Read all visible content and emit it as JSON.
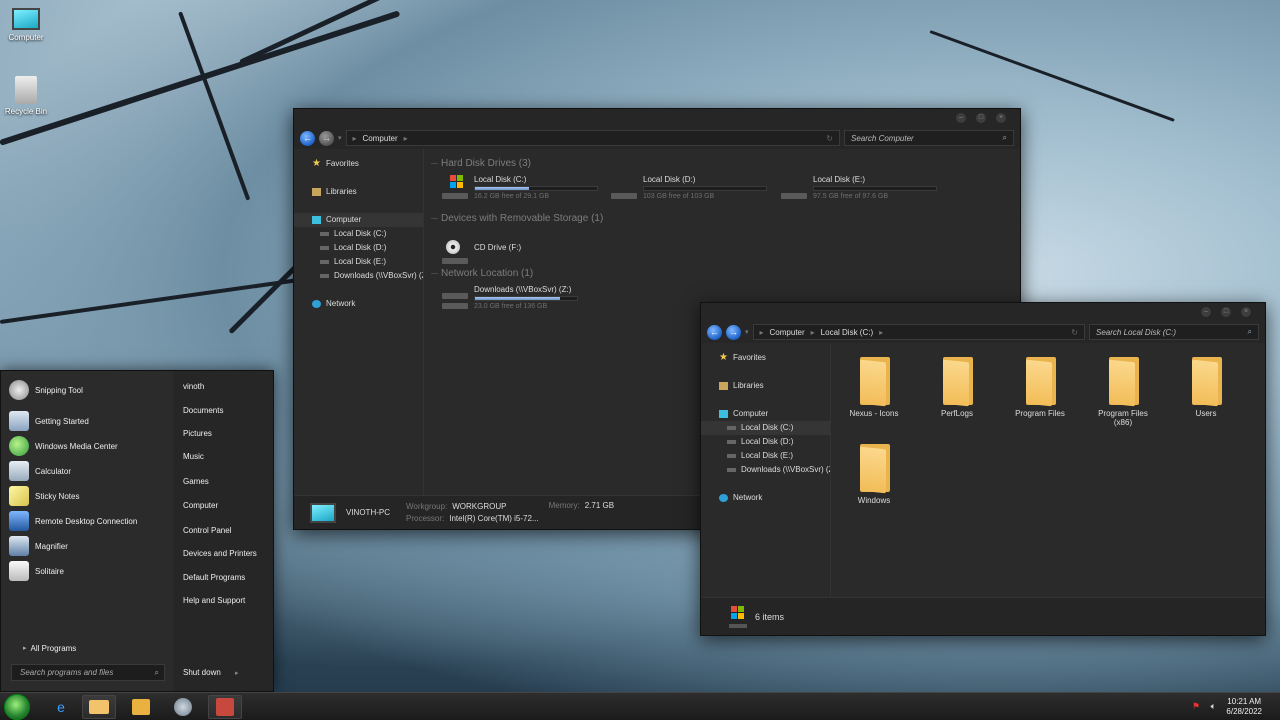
{
  "desktop": {
    "icons": [
      {
        "label": "Computer"
      },
      {
        "label": "Recycle Bin"
      }
    ]
  },
  "explorer_main": {
    "address": [
      "Computer"
    ],
    "search_placeholder": "Search Computer",
    "nav": {
      "favorites": "Favorites",
      "libraries": "Libraries",
      "computer": "Computer",
      "drives": [
        "Local Disk (C:)",
        "Local Disk (D:)",
        "Local Disk (E:)",
        "Downloads (\\\\VBoxSvr) (Z:)"
      ],
      "network": "Network"
    },
    "groups": {
      "hdd": "Hard Disk Drives (3)",
      "removable": "Devices with Removable Storage (1)",
      "network": "Network Location (1)"
    },
    "drives": [
      {
        "name": "Local Disk (C:)",
        "free": "16.2 GB free of 29.1 GB",
        "used_fraction": 0.44
      },
      {
        "name": "Local Disk (D:)",
        "free": "103 GB free of 103 GB",
        "used_fraction": 0.0
      },
      {
        "name": "Local Disk (E:)",
        "free": "97.5 GB free of 97.6 GB",
        "used_fraction": 0.0
      },
      {
        "name": "CD Drive (F:)"
      },
      {
        "name": "Downloads (\\\\VBoxSvr) (Z:)",
        "free": "23.0 GB free of 136 GB",
        "used_fraction": 0.83
      }
    ],
    "details": {
      "pc_name": "VINOTH-PC",
      "workgroup_label": "Workgroup:",
      "workgroup": "WORKGROUP",
      "memory_label": "Memory:",
      "memory": "2.71 GB",
      "processor_label": "Processor:",
      "processor": "Intel(R) Core(TM) i5-72..."
    }
  },
  "explorer_c": {
    "address": [
      "Computer",
      "Local Disk (C:)"
    ],
    "search_placeholder": "Search Local Disk (C:)",
    "nav": {
      "favorites": "Favorites",
      "libraries": "Libraries",
      "computer": "Computer",
      "drives": [
        "Local Disk (C:)",
        "Local Disk (D:)",
        "Local Disk (E:)",
        "Downloads (\\\\VBoxSvr) (Z:)"
      ],
      "network": "Network"
    },
    "folders": [
      "Nexus - Icons",
      "PerfLogs",
      "Program Files",
      "Program Files (x86)",
      "Users",
      "Windows"
    ],
    "status": "6 items"
  },
  "start_menu": {
    "programs": [
      "Snipping Tool",
      "Getting Started",
      "Windows Media Center",
      "Calculator",
      "Sticky Notes",
      "Remote Desktop Connection",
      "Magnifier",
      "Solitaire"
    ],
    "all_programs": "All Programs",
    "search_placeholder": "Search programs and files",
    "places": [
      "vinoth",
      "Documents",
      "Pictures",
      "Music",
      "Games",
      "Computer",
      "Control Panel",
      "Devices and Printers",
      "Default Programs",
      "Help and Support"
    ],
    "shutdown": "Shut down"
  },
  "taskbar": {
    "time": "10:21 AM",
    "date": "6/28/2022"
  }
}
